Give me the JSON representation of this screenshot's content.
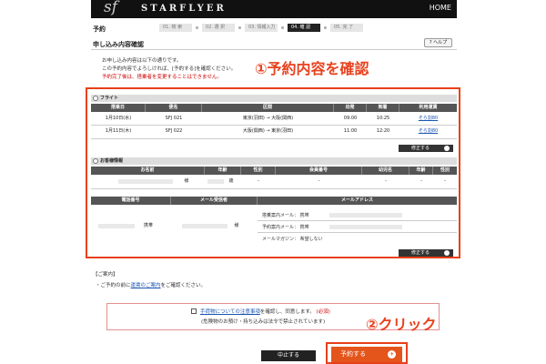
{
  "header": {
    "logo": "sf",
    "brand": "STARFLYER",
    "home": "HOME"
  },
  "steps": {
    "title": "予約",
    "items": [
      "01. 検 索",
      "02. 選 択",
      "03. 情報入力",
      "04. 確 認",
      "05. 完 了"
    ]
  },
  "page": {
    "title": "申し込み内容確認",
    "help": "ヘルプ"
  },
  "intro": [
    "お申し込み内容は以下の通りです。",
    "この予約内容でよろしければ、[予約する]を確認ください。",
    "予約完了後は、搭乗者を変更することはできません。"
  ],
  "annotations": {
    "step1": "①予約内容を確認",
    "step2": "②クリック"
  },
  "flight": {
    "title": "フライト",
    "headers": [
      "搭乗日",
      "便名",
      "区間",
      "出発",
      "到着",
      "利用運賃"
    ],
    "rows": [
      [
        "1月10日(水)",
        "SFJ 021",
        "東京(羽田) → 大阪(関西)",
        "09:00",
        "10:25",
        "そら割80"
      ],
      [
        "1月11日(木)",
        "SFJ 022",
        "大阪(関西) → 東京(羽田)",
        "11:00",
        "12:20",
        "そら割80"
      ]
    ],
    "edit": "修正する"
  },
  "customer": {
    "title": "お客様情報",
    "headers": [
      "お名前",
      "年齢",
      "性別",
      "会員番号",
      "幼児名",
      "年齢",
      "性別"
    ],
    "row": [
      "様",
      "歳",
      "-",
      "-",
      "-",
      "-",
      "-"
    ],
    "contact_headers": [
      "電話番号",
      "メール受信者",
      "メールアドレス"
    ],
    "phone_type": "携帯",
    "mail_recipient": "様",
    "mail_lines": [
      "搭乗案内メール： 携帯",
      "予約案内メール： 携帯",
      "メールマガジン： 希望しない"
    ],
    "edit": "修正する"
  },
  "notice": {
    "title": "【ご案内】",
    "line_prefix": "・ご予約の前に",
    "line_link": "運賃のご案内",
    "line_suffix": "をご確認ください。"
  },
  "agree": {
    "link": "手荷物についての注意事項",
    "text": "を確認し、同意します。",
    "required": "(必須)",
    "sub": "(危険物のお預け・持ち込みは法令で禁止されています)"
  },
  "buttons": {
    "cancel": "中止する",
    "reserve": "予約する"
  }
}
